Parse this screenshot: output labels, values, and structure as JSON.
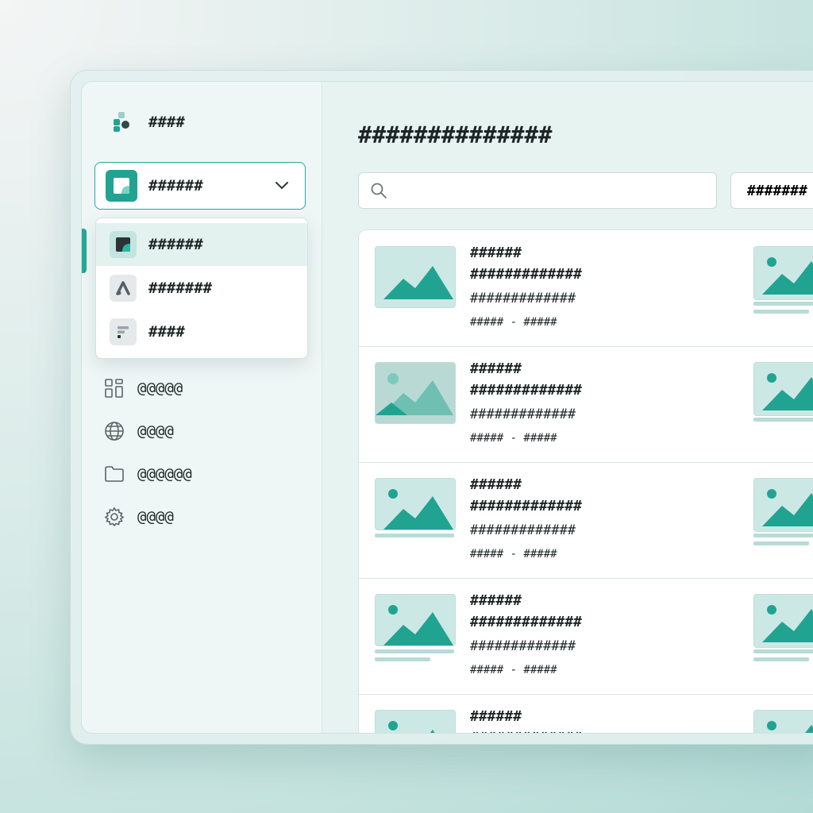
{
  "app": {
    "name": "####"
  },
  "workspace": {
    "selected": "######",
    "options": [
      {
        "label": "######",
        "icon": "square-logo-icon",
        "active": true
      },
      {
        "label": "#######",
        "icon": "a-logo-icon",
        "active": false
      },
      {
        "label": "####",
        "icon": "form-logo-icon",
        "active": false
      }
    ]
  },
  "nav": [
    {
      "label": "@@@@@",
      "icon": "dashboard-icon"
    },
    {
      "label": "@@@@",
      "icon": "globe-icon"
    },
    {
      "label": "@@@@@@",
      "icon": "folder-icon"
    },
    {
      "label": "@@@@",
      "icon": "settings-icon"
    }
  ],
  "main": {
    "title": "##############",
    "search": {
      "placeholder": ""
    },
    "filter_label": "#######"
  },
  "rows": [
    {
      "label": "######",
      "title": "#############",
      "subtitle": "#############",
      "meta": "##### - #####"
    },
    {
      "label": "######",
      "title": "#############",
      "subtitle": "#############",
      "meta": "##### - #####"
    },
    {
      "label": "######",
      "title": "#############",
      "subtitle": "#############",
      "meta": "##### - #####"
    },
    {
      "label": "######",
      "title": "#############",
      "subtitle": "#############",
      "meta": "##### - #####"
    },
    {
      "label": "######",
      "title": "#############",
      "subtitle": "",
      "meta": ""
    }
  ],
  "colors": {
    "accent": "#21a392",
    "accent_light": "#cce8e4",
    "background": "#d9ebe8"
  }
}
